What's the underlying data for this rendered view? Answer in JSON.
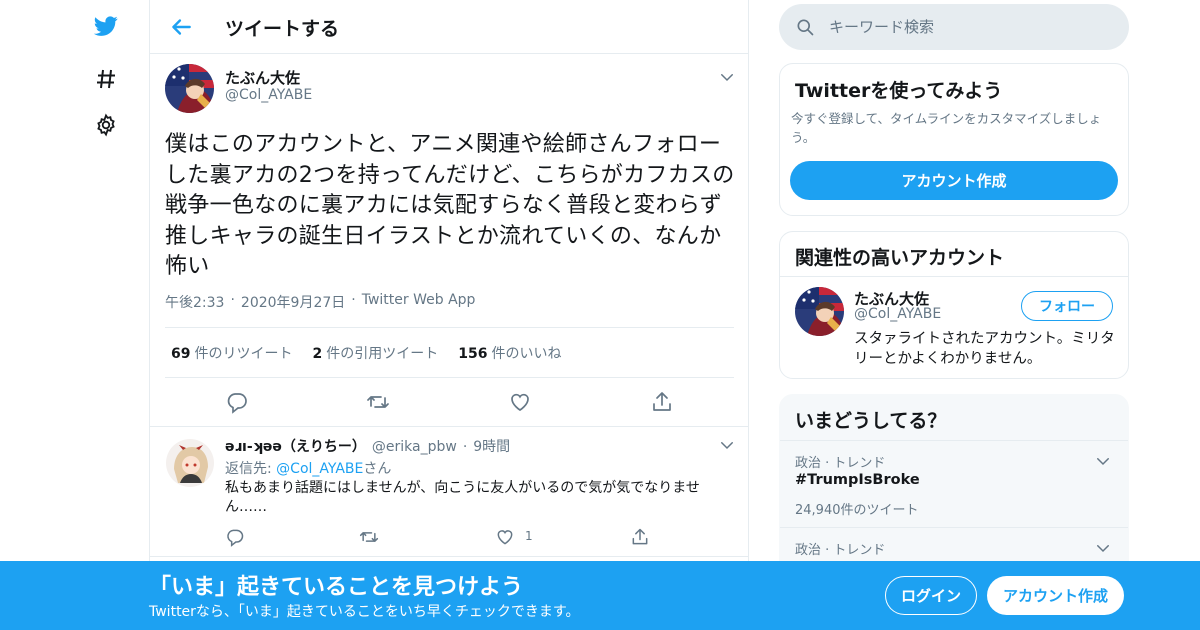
{
  "colors": {
    "accent": "#1da1f2",
    "text": "#14171a",
    "muted": "#657786",
    "border": "#e6ecf0"
  },
  "nav": {
    "icons": [
      "twitter-bird-icon",
      "hashtag-icon",
      "gear-icon"
    ]
  },
  "header": {
    "title": "ツイートする"
  },
  "tweet": {
    "name": "たぶん大佐",
    "handle": "@Col_AYABE",
    "text": "僕はこのアカウントと、アニメ関連や絵師さんフォローした裏アカの2つを持ってんだけど、こちらがカフカスの戦争一色なのに裏アカには気配すらなく普段と変わらず推しキャラの誕生日イラストとか流れていくの、なんか怖い",
    "time": "午後2:33",
    "date": "2020年9月27日",
    "source": "Twitter Web App",
    "stats": {
      "retweets_count": "69",
      "retweets_label": "件のリツイート",
      "quotes_count": "2",
      "quotes_label": "件の引用ツイート",
      "likes_count": "156",
      "likes_label": "件のいいね"
    }
  },
  "reply": {
    "name": "ǝɹı-ʞǝǝ（えりちー）",
    "handle": "@erika_pbw",
    "time": "9時間",
    "replying_prefix": "返信先: ",
    "replying_mention": "@Col_AYABE",
    "replying_suffix": "さん",
    "text": "私もあまり話題にはしませんが、向こうに友人がいるので気が気でなりません……",
    "like_count": "1"
  },
  "search": {
    "placeholder": "キーワード検索"
  },
  "signup_card": {
    "title": "Twitterを使ってみよう",
    "description": "今すぐ登録して、タイムラインをカスタマイズしましょう。",
    "button": "アカウント作成"
  },
  "related_card": {
    "title": "関連性の高いアカウント",
    "name": "たぶん大佐",
    "handle": "@Col_AYABE",
    "follow_button": "フォロー",
    "bio": "スタァライトされたアカウント。ミリタリーとかよくわかりません。"
  },
  "trends_card": {
    "title": "いまどうしてる？",
    "items": [
      {
        "category": "政治 · トレンド",
        "name": "#TrumpIsBroke",
        "count": "24,940件のツイート"
      },
      {
        "category": "政治 · トレンド",
        "name": "",
        "count": ""
      }
    ]
  },
  "banner": {
    "title": "「いま」起きていることを見つけよう",
    "subtitle": "Twitterなら、「いま」起きていることをいち早くチェックできます。",
    "login_button": "ログイン",
    "signup_button": "アカウント作成"
  }
}
